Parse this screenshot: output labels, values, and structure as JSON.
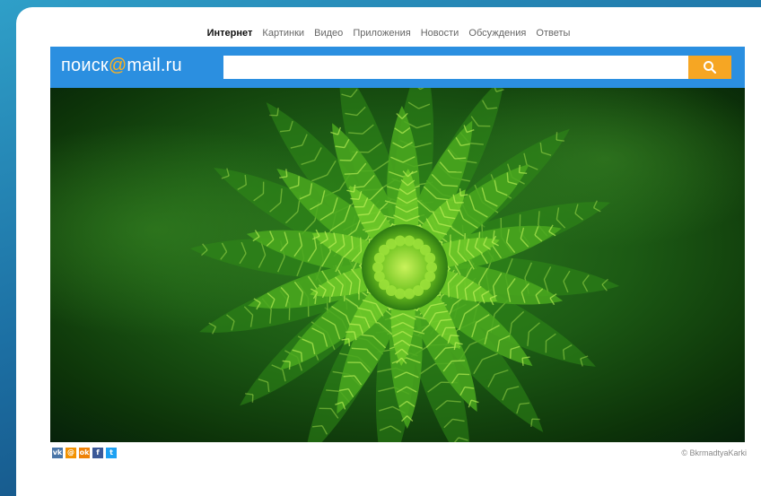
{
  "nav": {
    "tabs": [
      {
        "label": "Интернет",
        "active": true
      },
      {
        "label": "Картинки",
        "active": false
      },
      {
        "label": "Видео",
        "active": false
      },
      {
        "label": "Приложения",
        "active": false
      },
      {
        "label": "Новости",
        "active": false
      },
      {
        "label": "Обсуждения",
        "active": false
      },
      {
        "label": "Ответы",
        "active": false
      }
    ]
  },
  "logo": {
    "part1": "поиск",
    "at": "@",
    "part2": "mail",
    "tld": ".ru"
  },
  "search": {
    "value": "",
    "placeholder": "",
    "button_icon": "search-icon"
  },
  "hero": {
    "image_icon": "green-plant-photo"
  },
  "social": [
    {
      "name": "vk",
      "label": "vk",
      "color": "#4a76a8"
    },
    {
      "name": "mail",
      "label": "@",
      "color": "#f39200"
    },
    {
      "name": "ok",
      "label": "ok",
      "color": "#ee8208"
    },
    {
      "name": "facebook",
      "label": "f",
      "color": "#3b5998"
    },
    {
      "name": "twitter",
      "label": "t",
      "color": "#1da1f2"
    }
  ],
  "credit": "© BkrmadtyaKarki",
  "colors": {
    "header_blue": "#2b8fe0",
    "search_orange": "#f6a623",
    "logo_at": "#ffb21e"
  }
}
